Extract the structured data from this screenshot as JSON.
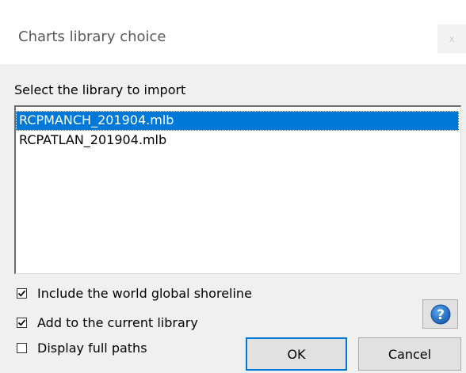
{
  "window": {
    "title": "Charts library choice",
    "close_glyph": "x"
  },
  "dialog": {
    "prompt": "Select the library to import",
    "libraries": [
      {
        "name": "RCPMANCH_201904.mlb",
        "selected": true
      },
      {
        "name": "RCPATLAN_201904.mlb",
        "selected": false
      }
    ],
    "options": [
      {
        "label": "Include the world global shoreline",
        "checked": true
      },
      {
        "label": "Add to the current library",
        "checked": true
      },
      {
        "label": "Display full paths",
        "checked": false
      }
    ],
    "buttons": {
      "ok": "OK",
      "cancel": "Cancel"
    },
    "help_icon": "question-mark",
    "colors": {
      "selection": "#0078d7",
      "help_icon": "#1a6fc4",
      "client_bg": "#f0f0f0"
    }
  }
}
